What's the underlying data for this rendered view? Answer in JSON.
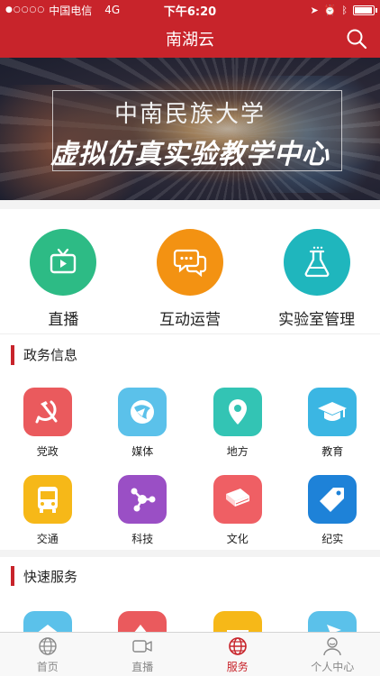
{
  "status": {
    "carrier": "中国电信",
    "network": "4G",
    "time": "下午6:20"
  },
  "header": {
    "title": "南湖云"
  },
  "banner": {
    "line1": "中南民族大学",
    "line2": "虚拟仿真实验教学中心"
  },
  "quick_actions": [
    {
      "label": "直播",
      "icon": "tv-icon",
      "color": "#2dbb85"
    },
    {
      "label": "互动运营",
      "icon": "chat-icon",
      "color": "#f39212"
    },
    {
      "label": "实验室管理",
      "icon": "flask-icon",
      "color": "#1fb6bd"
    }
  ],
  "sections": [
    {
      "title": "政务信息",
      "items": [
        {
          "label": "党政",
          "icon": "hammer-sickle-icon",
          "color": "#ea5a5d"
        },
        {
          "label": "媒体",
          "icon": "globe-icon",
          "color": "#5bc1ea"
        },
        {
          "label": "地方",
          "icon": "location-pin-icon",
          "color": "#33c4b4"
        },
        {
          "label": "教育",
          "icon": "graduation-cap-icon",
          "color": "#3bb6e3"
        },
        {
          "label": "交通",
          "icon": "bus-icon",
          "color": "#f6b818"
        },
        {
          "label": "科技",
          "icon": "molecule-icon",
          "color": "#9a4fc5"
        },
        {
          "label": "文化",
          "icon": "book-icon",
          "color": "#ef5f64"
        },
        {
          "label": "纪实",
          "icon": "tag-icon",
          "color": "#1e82d8"
        }
      ]
    },
    {
      "title": "快速服务",
      "items": [
        {
          "label": "",
          "icon": "house-icon",
          "color": "#5bc1ea"
        },
        {
          "label": "",
          "icon": "arrow-icon",
          "color": "#ea5a5d"
        },
        {
          "label": "",
          "icon": "card-icon",
          "color": "#f6b818"
        },
        {
          "label": "",
          "icon": "plane-icon",
          "color": "#5bc1ea"
        }
      ]
    }
  ],
  "tabs": [
    {
      "label": "首页",
      "icon": "globe-outline-icon"
    },
    {
      "label": "直播",
      "icon": "camera-icon"
    },
    {
      "label": "服务",
      "icon": "globe-outline-icon",
      "active": true
    },
    {
      "label": "个人中心",
      "icon": "person-icon"
    }
  ]
}
